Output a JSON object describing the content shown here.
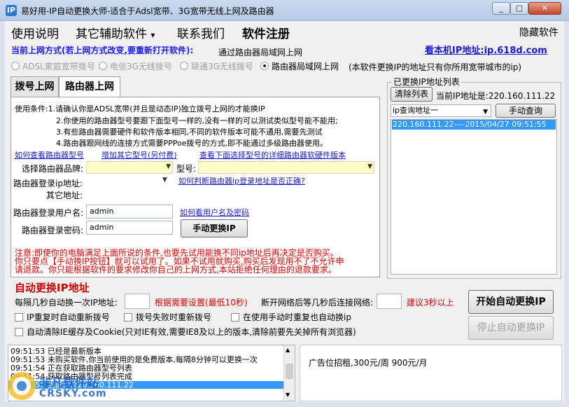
{
  "window": {
    "title": "易好用-IP自动更换大师-适合于Adsl宽带、3G宽带无线上网及路由器",
    "min": "_",
    "max": "□",
    "close": "✕"
  },
  "menu": {
    "help": "使用说明",
    "tools": "其它辅助软件",
    "tools_arrow": "▾",
    "contact": "联系我们",
    "register": "软件注册",
    "hide": "隐藏软件"
  },
  "mode": {
    "label": "当前上网方式(若上网方式改变,要重新打开软件):",
    "value": "通过路由器局域网上网",
    "ip_link": "看本机IP地址:ip.618d.com",
    "options": [
      {
        "label": "ADSL家庭宽带拨号",
        "selected": false,
        "disabled": true
      },
      {
        "label": "电信3G无线拨号",
        "selected": false,
        "disabled": true
      },
      {
        "label": "联通3G无线拨号",
        "selected": false,
        "disabled": true
      },
      {
        "label": "路由器局域网上网",
        "selected": true,
        "disabled": false
      }
    ],
    "note": "(本软件更换IP的地址只有你所用宽带城市的ip)"
  },
  "tabs": [
    {
      "label": "拨号上网",
      "active": false
    },
    {
      "label": "路由器上网",
      "active": true
    }
  ],
  "router": {
    "conditions": [
      "使用条件:1.请确认你是ADSL宽带(并且是动态IP)独立拨号上网的才能换IP",
      "2.你使用的路由器型号要跟下面型号一样的,没有一样的可以测试类似型号能不能用;",
      "3.有些路由器需要硬件和软件版本相同,不同的软件版本可能不通用,需要先测试",
      "4.路由器跟网线的连接方式需要PPPoe拨号的方式,即不能通过多级路由器使用。"
    ],
    "link_view_model": "如何查看路由器型号",
    "link_add_model": "增加其它型号(另付费)",
    "link_detail": "查看下面选择型号的详细路由器软硬件版本",
    "brand_label": "选择路由器品牌:",
    "model_label": "型号:",
    "login_ip_label": "路由器登录ip地址:",
    "other_addr_label": "其它地址:",
    "link_check_ip": "如何判断路由器ip登录地址是否正确?",
    "user_label": "路由器登录用户名:",
    "user_value": "admin",
    "link_view_user": "如何看用户名及密码",
    "pass_label": "路由器登录密码:",
    "pass_value": "admin",
    "change_button": "手动更换IP",
    "warning": [
      "注意:即使你的电脑满足上面所说的条件,也要先试用能换不同ip地址后再决定是否购买。",
      "你只要点【手动换IP按钮】就可以试用了。如果不试用就购买,购买后发现用不了不允许申",
      "请退款。你只能根据软件的要求修改你自己的上网方式,本站拒绝任何理由的退款要求。"
    ]
  },
  "ip_panel": {
    "group_label": "已更换IP地址列表",
    "clear_button": "清除列表",
    "current_ip": "当前IP地址是:220.160.111.22",
    "query_select": "ip查询地址一",
    "query_button": "手动查询",
    "entries": [
      "220.160.111.22----2015/04/27 09:51:55"
    ]
  },
  "auto": {
    "title": "自动更换IP地址",
    "interval_label": "每隔几秒自动换一次IP地址:",
    "interval_hint": "根据需要设置(最低10秒)",
    "reconnect_label": "断开网络后等几秒后连接网络:",
    "reconnect_hint": "建议3秒以上",
    "cb_repeat_redial": "IP重复时自动重新拨号",
    "cb_fail_redial": "拨号失败时重新拨号",
    "cb_manual_repeat": "在使用手动时重复也自动换ip",
    "cb_clear_cookie": "自动清除IE缓存及Cookie(只对IE有效,需要IE8及以上的版本,清除前要先关掉所有浏览器)",
    "start_button": "开始自动更换IP",
    "stop_button": "停止自动更换IP"
  },
  "log": [
    "09:51:53 已经是最新版本",
    "09:51:53 未购买软件,你当前使用的是免费版本,每隔8分钟可以更换一次",
    "09:51:54 正在获取路由器型号列表",
    "09:51:54 获取路由器型号列表完成",
    "09:51:55 当前IP:220.160.111.22"
  ],
  "ad": "广告位招租,300元/周 900元/月",
  "watermark": {
    "cn": "非凡软件站",
    "en": "CRSKY.com"
  },
  "colors": {
    "accent_blue": "#1a1aff",
    "warning_red": "#e00000",
    "selection": "#3399ff"
  }
}
